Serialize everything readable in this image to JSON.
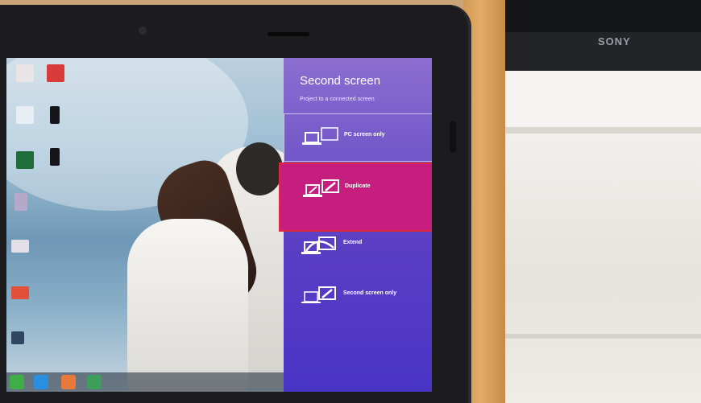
{
  "tv": {
    "brand": "SONY"
  },
  "projection_panel": {
    "title": "Second screen",
    "subtitle": "Project to a connected screen",
    "options": [
      {
        "label": "PC screen only",
        "icon": "pc-screen-only-icon"
      },
      {
        "label": "Duplicate",
        "icon": "duplicate-icon",
        "selected": true
      },
      {
        "label": "Extend",
        "icon": "extend-icon"
      },
      {
        "label": "Second screen only",
        "icon": "second-screen-only-icon"
      }
    ]
  },
  "colors": {
    "panel_top": "#8c6ed0",
    "panel_bottom": "#4a34c6",
    "selected_option": "#c51e7e",
    "selected_border": "#e0273d"
  }
}
